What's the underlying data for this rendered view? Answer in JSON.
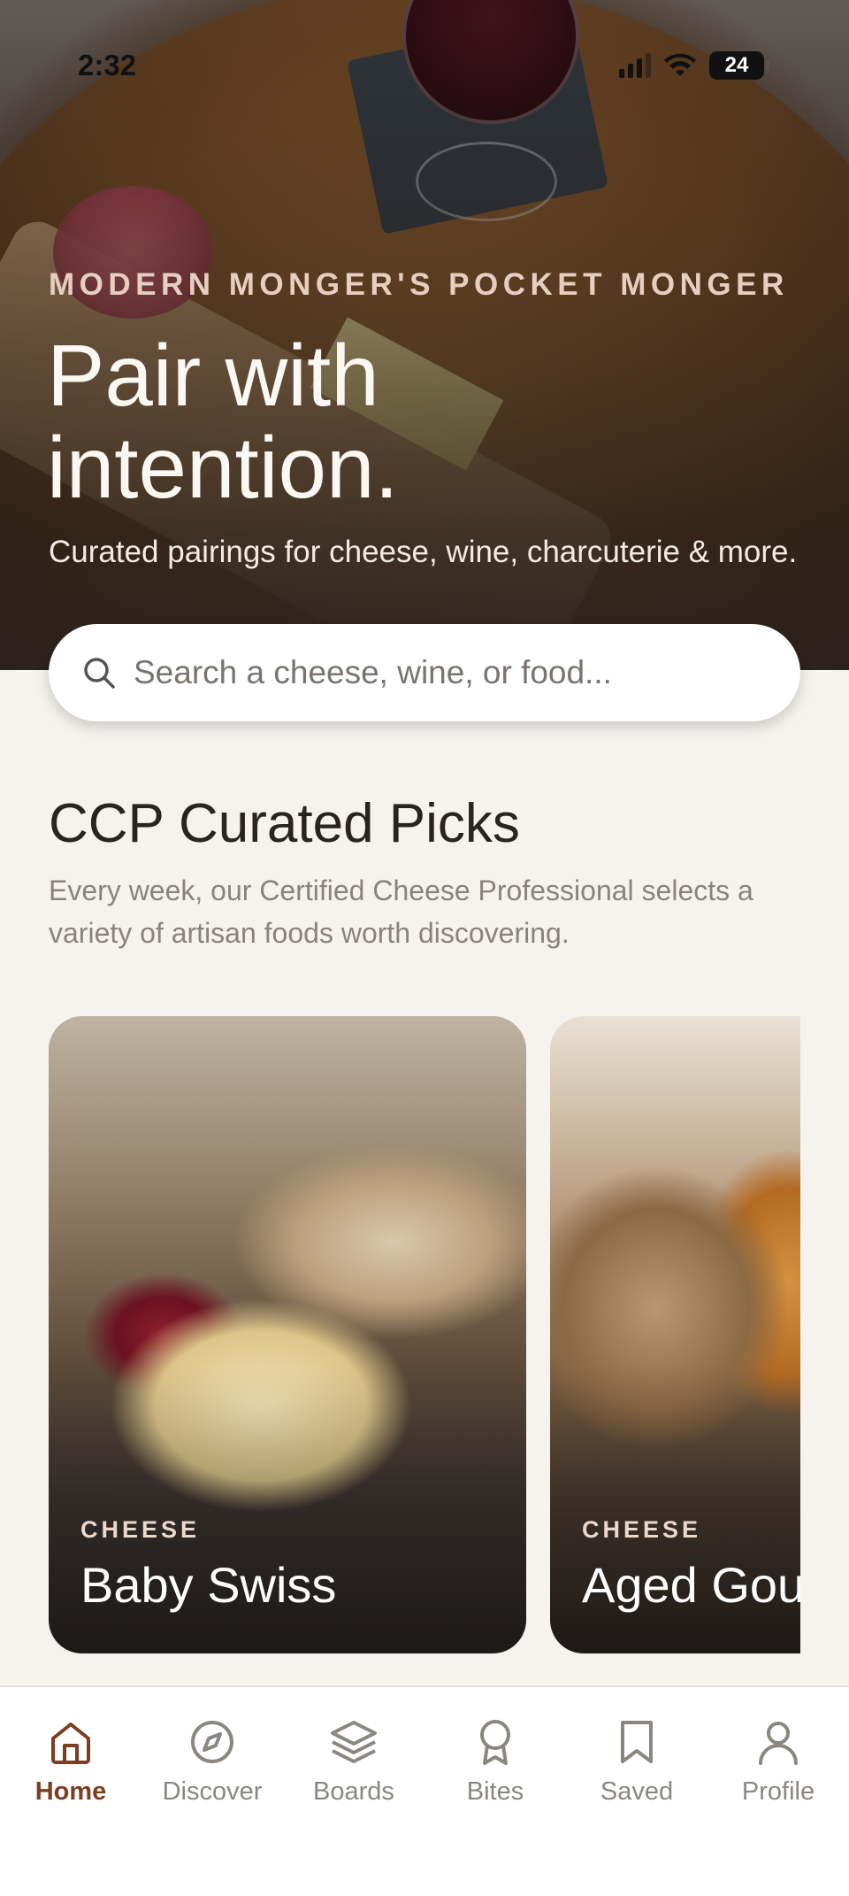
{
  "status_bar": {
    "time": "2:32",
    "battery": "24"
  },
  "hero": {
    "eyebrow": "MODERN MONGER'S POCKET MONGER",
    "headline_line1": "Pair with",
    "headline_line2": "intention.",
    "subhead": "Curated pairings for cheese, wine, charcuterie & more."
  },
  "search": {
    "placeholder": "Search a cheese, wine, or food..."
  },
  "section": {
    "title": "CCP Curated Picks",
    "description": "Every week, our Certified Cheese Professional selects a variety of artisan foods worth discovering."
  },
  "cards": [
    {
      "category": "CHEESE",
      "name": "Baby Swiss"
    },
    {
      "category": "CHEESE",
      "name": "Aged Gouda"
    }
  ],
  "tabs": [
    {
      "label": "Home",
      "icon": "home-icon",
      "active": true
    },
    {
      "label": "Discover",
      "icon": "compass-icon",
      "active": false
    },
    {
      "label": "Boards",
      "icon": "layers-icon",
      "active": false
    },
    {
      "label": "Bites",
      "icon": "award-icon",
      "active": false
    },
    {
      "label": "Saved",
      "icon": "bookmark-icon",
      "active": false
    },
    {
      "label": "Profile",
      "icon": "user-icon",
      "active": false
    }
  ],
  "colors": {
    "accent": "#7a3e22",
    "inactive": "#8c8681",
    "background": "#f6f3ee"
  }
}
